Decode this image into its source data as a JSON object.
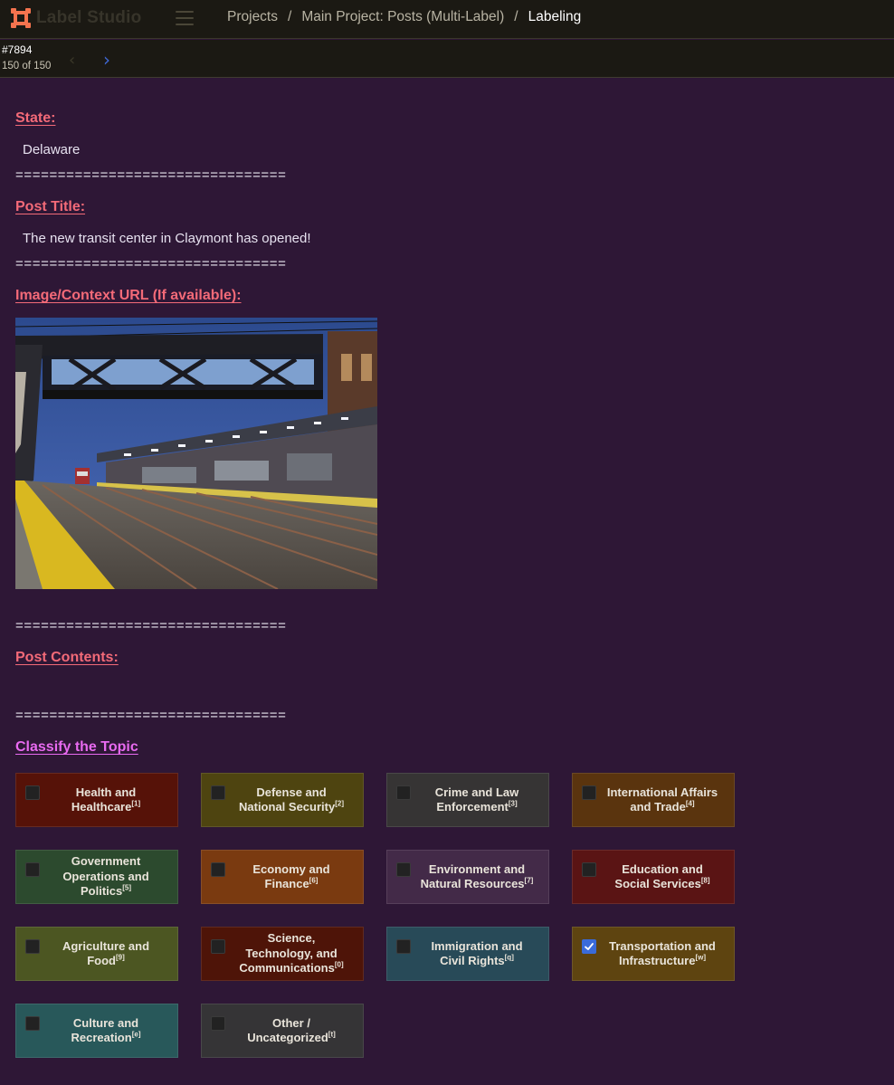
{
  "app": {
    "name": "Label Studio",
    "brand_color": "#f4734e"
  },
  "breadcrumb": {
    "items": [
      "Projects",
      "Main Project: Posts (Multi-Label)",
      "Labeling"
    ],
    "separator": "/"
  },
  "task": {
    "id": "#7894",
    "position": "150 of 150"
  },
  "fields": {
    "state_label": "State:",
    "state_value": "Delaware",
    "divider": "================================",
    "title_label": "Post Title:",
    "title_value": "The new transit center in Claymont has opened!",
    "image_label": "Image/Context URL (If available):",
    "contents_label": "Post Contents:",
    "contents_value": ""
  },
  "classification": {
    "heading": "Classify the Topic",
    "choices": [
      {
        "label": "Health and Healthcare",
        "hotkey": "[1]",
        "color": "#561208",
        "checked": false
      },
      {
        "label": "Defense and National Security",
        "hotkey": "[2]",
        "color": "#4e4410",
        "checked": false
      },
      {
        "label": "Crime and Law Enforcement",
        "hotkey": "[3]",
        "color": "#363434",
        "checked": false
      },
      {
        "label": "International Affairs and Trade",
        "hotkey": "[4]",
        "color": "#5a340e",
        "checked": false
      },
      {
        "label": "Government Operations and Politics",
        "hotkey": "[5]",
        "color": "#2c4a2e",
        "checked": false
      },
      {
        "label": "Economy and Finance",
        "hotkey": "[6]",
        "color": "#7a3a10",
        "checked": false
      },
      {
        "label": "Environment and Natural Resources",
        "hotkey": "[7]",
        "color": "#432a48",
        "checked": false
      },
      {
        "label": "Education and Social Services",
        "hotkey": "[8]",
        "color": "#5a1414",
        "checked": false
      },
      {
        "label": "Agriculture and Food",
        "hotkey": "[9]",
        "color": "#4c5622",
        "checked": false
      },
      {
        "label": "Science, Technology, and Communications",
        "hotkey": "[0]",
        "color": "#4e1408",
        "checked": false
      },
      {
        "label": "Immigration and Civil Rights",
        "hotkey": "[q]",
        "color": "#284a58",
        "checked": false
      },
      {
        "label": "Transportation and Infrastructure",
        "hotkey": "[w]",
        "color": "#5e4410",
        "checked": true
      },
      {
        "label": "Culture and Recreation",
        "hotkey": "[e]",
        "color": "#28585a",
        "checked": false
      },
      {
        "label": "Other / Uncategorized",
        "hotkey": "[t]",
        "color": "#353436",
        "checked": false
      }
    ]
  }
}
